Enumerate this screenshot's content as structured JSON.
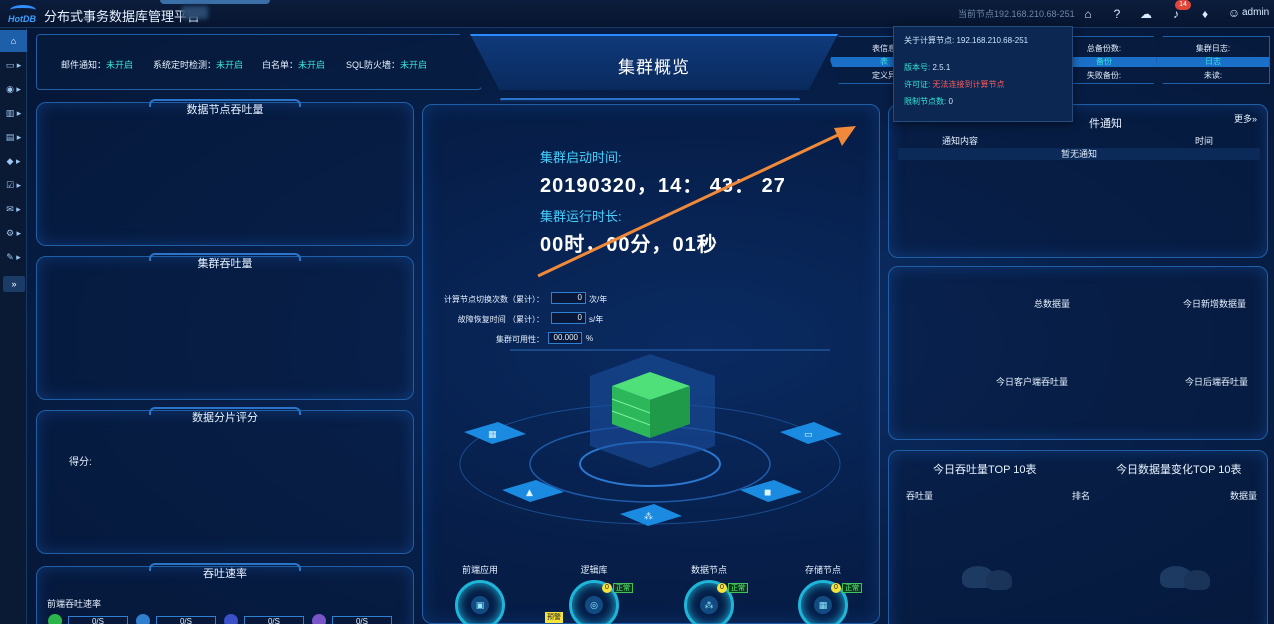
{
  "app": {
    "logo_text": "HotDB",
    "title": "分布式事务数据库管理平台"
  },
  "topbar": {
    "node_info": "当前节点192.168.210.68-251",
    "notification_count": "14",
    "user_name": "admin",
    "icons": [
      "home-icon",
      "help-icon",
      "cloud-icon",
      "cloud-download-icon",
      "bell-icon",
      "shirt-icon",
      "user-icon"
    ]
  },
  "sidebar": {
    "items": [
      {
        "icon": "home-icon",
        "glyph": "⌂"
      },
      {
        "icon": "monitor-icon",
        "glyph": "▭"
      },
      {
        "icon": "eye-icon",
        "glyph": "◉"
      },
      {
        "icon": "chart-icon",
        "glyph": "▥"
      },
      {
        "icon": "database-icon",
        "glyph": "▤"
      },
      {
        "icon": "shield-icon",
        "glyph": "◆"
      },
      {
        "icon": "check-icon",
        "glyph": "☑"
      },
      {
        "icon": "mail-icon",
        "glyph": "✉"
      },
      {
        "icon": "settings-icon",
        "glyph": "⚙"
      },
      {
        "icon": "tools-icon",
        "glyph": "✎"
      },
      {
        "icon": "expand-icon",
        "glyph": "»"
      }
    ]
  },
  "status_bar": {
    "items": [
      {
        "label": "邮件通知：",
        "value": "未开启"
      },
      {
        "label": "系统定时检测：",
        "value": "未开启"
      },
      {
        "label": "白名单：",
        "value": "未开启"
      },
      {
        "label": "SQL防火墙：",
        "value": "未开启"
      }
    ]
  },
  "center": {
    "title": "集群概览",
    "start_label": "集群启动时间:",
    "start_value": "20190320，14： 43： 27",
    "runtime_label": "集群运行时长:",
    "runtime_value": "00时，00分，01秒",
    "metrics": [
      {
        "label": "计算节点切换次数（累计）：",
        "value": "0",
        "unit": "次/年"
      },
      {
        "label": "故障恢复时间 （累计）：",
        "value": "0",
        "unit": "s/年"
      },
      {
        "label": "集群可用性：",
        "value": "00.000",
        "unit": "%"
      }
    ],
    "nodes": [
      {
        "label": "前端应用",
        "icon": "app-icon",
        "glyph": "▣"
      },
      {
        "label": "逻辑库",
        "icon": "logic-db-icon",
        "glyph": "◎",
        "count": "0",
        "status": "正常",
        "warn": "预警"
      },
      {
        "label": "数据节点",
        "icon": "data-node-icon",
        "glyph": "⁂",
        "count": "0",
        "status": "正常"
      },
      {
        "label": "存储节点",
        "icon": "storage-icon",
        "glyph": "▦",
        "count": "0",
        "status": "正常"
      }
    ]
  },
  "left": {
    "panel1_title": "数据节点吞吐量",
    "panel2_title": "集群吞吐量",
    "panel3_title": "数据分片评分",
    "score_label": "得分:",
    "panel4_title": "吞吐速率",
    "rate_label": "前端吞吐速率",
    "rates": [
      {
        "dot": "#2bb54a",
        "value": "0/S"
      },
      {
        "dot": "#2f7fd0",
        "value": "0/S"
      },
      {
        "dot": "#3b4fc8",
        "value": "0/S"
      },
      {
        "dot": "#7a55c8",
        "value": "0/S"
      }
    ]
  },
  "right": {
    "headers": [
      {
        "title": "表信息",
        "bar": "表",
        "under": "定义异"
      },
      {
        "title": "总备份数:",
        "bar": "备份",
        "under": "失败备份:"
      },
      {
        "title": "集群日志:",
        "bar": "日志",
        "under": "未读:"
      }
    ],
    "tooltip": {
      "about_label": "关于计算节点:",
      "about_value": "192.168.210.68-251",
      "version_label": "版本号:",
      "version_value": "2.5.1",
      "license_label": "许可证:",
      "license_value": "无法连接到计算节点",
      "limit_label": "限制节点数:",
      "limit_value": "0"
    },
    "notice_title": "件通知",
    "more_label": "更多»",
    "notice_cols": [
      "通知内容",
      "时间"
    ],
    "notice_empty": "暂无通知",
    "stats": [
      "总数据量",
      "今日新增数据量",
      "今日客户端吞吐量",
      "今日后端吞吐量"
    ],
    "top10_title1": "今日吞吐量TOP 10表",
    "top10_title2": "今日数据量变化TOP 10表",
    "top10_cols": [
      "吞吐量",
      "排名",
      "数据量"
    ]
  },
  "colors": {
    "accent": "#35e4d8",
    "highlight": "#45d0ff",
    "arrow": "#f08a3a",
    "server": "#2fd07a"
  }
}
